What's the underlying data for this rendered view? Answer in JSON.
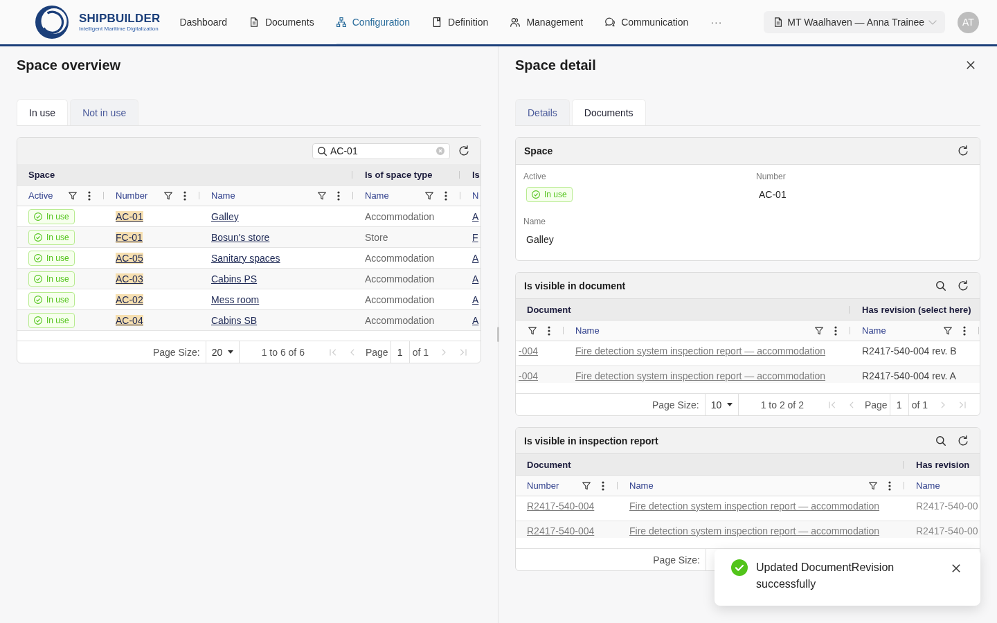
{
  "header": {
    "brand": {
      "name": "SHIPBUILDER",
      "tagline": "Intelligent Maritime Digitalization"
    },
    "nav": [
      {
        "label": "Dashboard",
        "selected": false
      },
      {
        "label": "Documents",
        "selected": false
      },
      {
        "label": "Configuration",
        "selected": true
      },
      {
        "label": "Definition",
        "selected": false
      },
      {
        "label": "Management",
        "selected": false
      },
      {
        "label": "Communication",
        "selected": false
      }
    ],
    "more": "···",
    "context": "MT Waalhaven — Anna Trainee",
    "avatar": "AT"
  },
  "overview": {
    "title": "Space overview",
    "tabs": [
      {
        "label": "In use",
        "selected": true
      },
      {
        "label": "Not in use",
        "selected": false
      }
    ],
    "grid": {
      "search": {
        "value": "AC-01"
      },
      "groups": [
        {
          "label": "Space",
          "columns": [
            {
              "kind": "filter",
              "label": "Active"
            },
            {
              "kind": "filter",
              "label": "Number"
            },
            {
              "kind": "filter",
              "label": "Name"
            }
          ]
        },
        {
          "label": "Is of space type",
          "columns": [
            {
              "kind": "filter",
              "label": "Name"
            }
          ]
        },
        {
          "label": "Is",
          "columns": [
            {
              "kind": "label",
              "label": "N"
            }
          ]
        }
      ],
      "rows": [
        {
          "status": "In use",
          "number": "AC-01",
          "highlighted": true,
          "name": "Galley",
          "space_type": "Accommodation",
          "column_5": "A"
        },
        {
          "status": "In use",
          "number": "FC-01",
          "highlighted": true,
          "name": "Bosun's store",
          "space_type": "Store",
          "column_5": "F"
        },
        {
          "status": "In use",
          "number": "AC-05",
          "highlighted": true,
          "name": "Sanitary spaces",
          "space_type": "Accommodation",
          "column_5": "A"
        },
        {
          "status": "In use",
          "number": "AC-03",
          "highlighted": true,
          "name": "Cabins PS",
          "space_type": "Accommodation",
          "column_5": "A"
        },
        {
          "status": "In use",
          "number": "AC-02",
          "highlighted": true,
          "name": "Mess room",
          "space_type": "Accommodation",
          "column_5": "A"
        },
        {
          "status": "In use",
          "number": "AC-04",
          "highlighted": true,
          "name": "Cabins SB",
          "space_type": "Accommodation",
          "column_5": "A"
        }
      ],
      "pagination": {
        "page_size_label": "Page Size:",
        "page_size": "20",
        "range": "1 to 6 of 6",
        "page_label": "Page",
        "page": "1",
        "page_count": "of 1",
        "navigation_disabled": true
      }
    }
  },
  "detail": {
    "title": "Space detail",
    "tabs": [
      {
        "label": "Details",
        "selected": false
      },
      {
        "label": "Documents",
        "selected": true
      }
    ],
    "space": {
      "title": "Space",
      "fields": [
        {
          "label": "Active",
          "kind": "badge",
          "value": "In use"
        },
        {
          "label": "Number",
          "kind": "text",
          "value": "AC-01"
        },
        {
          "label": "Name",
          "kind": "text",
          "value": "Galley"
        }
      ]
    },
    "document_table": {
      "title": "Is visible in document",
      "groups": [
        {
          "label": "Document",
          "columns": [
            {
              "kind": "icons"
            },
            {
              "kind": "filter",
              "label": "Name"
            }
          ]
        },
        {
          "label": "Has revision (select here)",
          "columns": [
            {
              "kind": "filter",
              "label": "Name"
            }
          ]
        }
      ],
      "rows": [
        {
          "number": "-004",
          "name": "Fire detection system inspection report — accommodation",
          "revision": "R2417-540-004 rev. B"
        },
        {
          "number": "-004",
          "name": "Fire detection system inspection report — accommodation",
          "revision": "R2417-540-004 rev. A"
        }
      ],
      "pagination": {
        "page_size_label": "Page Size:",
        "page_size": "10",
        "range": "1 to 2 of 2",
        "page_label": "Page",
        "page": "1",
        "page_count": "of 1",
        "navigation_disabled": true
      }
    },
    "inspection_table": {
      "title": "Is visible in inspection report",
      "groups": [
        {
          "label": "Document",
          "columns": [
            {
              "kind": "filter",
              "label": "Number"
            },
            {
              "kind": "filter",
              "label": "Name"
            }
          ]
        },
        {
          "label": "Has revision",
          "columns": [
            {
              "kind": "label",
              "label": "Name"
            }
          ]
        }
      ],
      "rows": [
        {
          "number": "R2417-540-004",
          "name": "Fire detection system inspection report — accommodation",
          "revision": "R2417-540-00"
        },
        {
          "number": "R2417-540-004",
          "name": "Fire detection system inspection report — accommodation",
          "revision": "R2417-540-00"
        }
      ],
      "pagination": {
        "page_size_label": "Page Size:"
      }
    }
  },
  "toast": {
    "message": "Updated DocumentRevision successfully"
  }
}
